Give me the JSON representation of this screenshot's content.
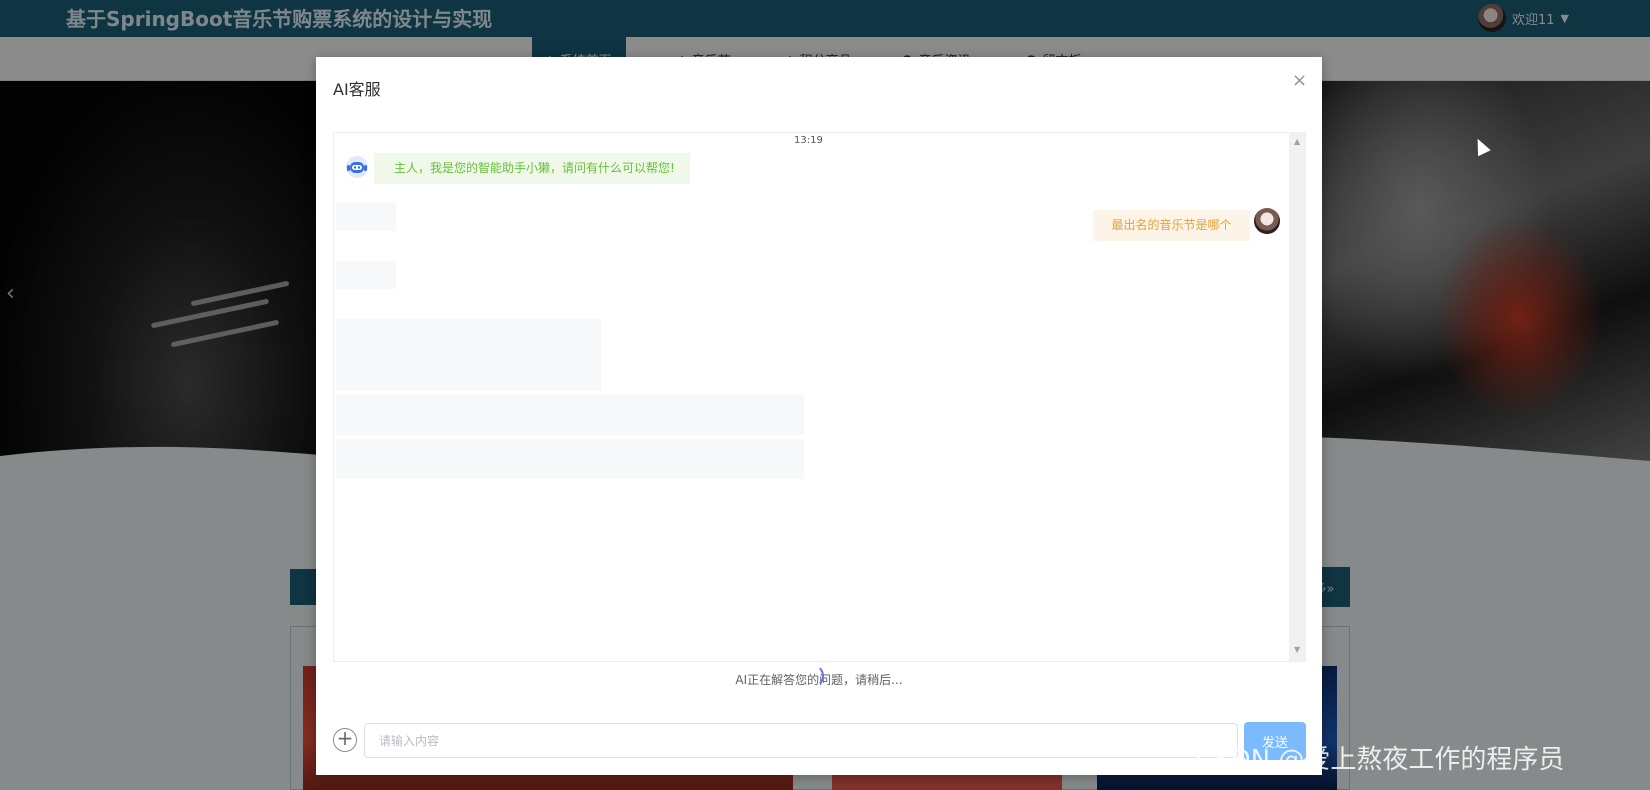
{
  "header": {
    "site_title": "基于SpringBoot音乐节购票系统的设计与实现",
    "user_welcome": "欢迎11"
  },
  "nav": {
    "items": [
      {
        "label": "系统首页",
        "active": true
      },
      {
        "label": "音乐节",
        "active": false
      },
      {
        "label": "积分商品",
        "active": false
      },
      {
        "label": "音乐资讯",
        "active": false
      },
      {
        "label": "留言板",
        "active": false
      }
    ]
  },
  "page": {
    "more_label": "多»"
  },
  "dialog": {
    "title": "AI客服",
    "close_glyph": "×",
    "chat": {
      "timestamp": "13:19",
      "messages": [
        {
          "role": "bot",
          "text": "主人，我是您的智能助手小獭，请问有什么可以帮您!"
        },
        {
          "role": "user",
          "text": "最出名的音乐节是哪个"
        }
      ]
    },
    "loading_text": "AI正在解答您的问题，请稍后...",
    "input": {
      "placeholder": "请输入内容",
      "value": ""
    },
    "add_glyph": "+",
    "send_label": "发送"
  },
  "watermark": "CSDN @爱上熬夜工作的程序员",
  "colors": {
    "header_bg": "#1b5a73",
    "bot_text": "#67c23a",
    "bot_bubble": "#f0f8ea",
    "user_text": "#e6a23c",
    "user_bubble": "#fdf4e8",
    "send_button": "#7cbaff"
  }
}
